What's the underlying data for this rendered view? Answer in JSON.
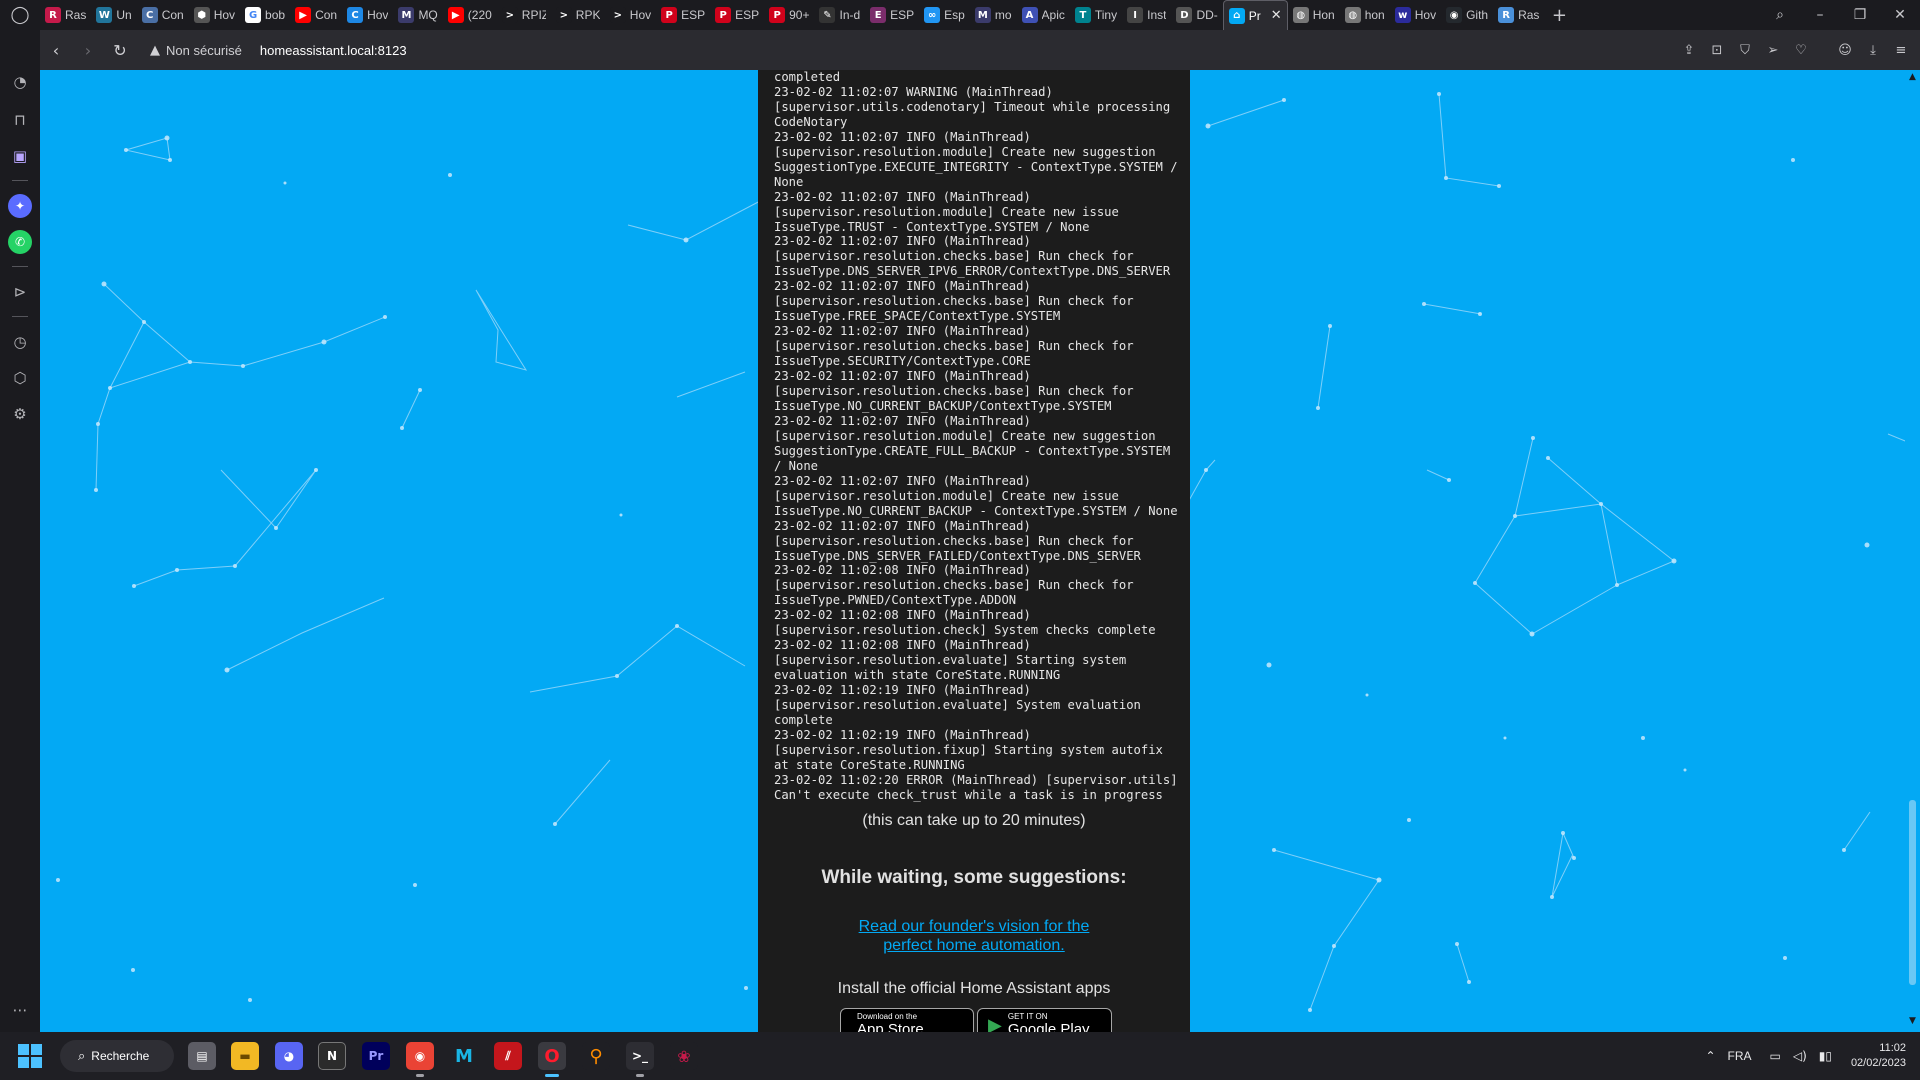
{
  "browser": {
    "tabs": [
      {
        "label": "Ras",
        "icon": "raspberry-favicon-icon",
        "color": "#c51a4a",
        "glyph": "R"
      },
      {
        "label": "Un",
        "icon": "wordpress-favicon-icon",
        "color": "#21759b",
        "glyph": "W"
      },
      {
        "label": "Con",
        "icon": "globe-favicon-icon",
        "color": "#4a6fa5",
        "glyph": "C"
      },
      {
        "label": "Hov",
        "icon": "hexagon-favicon-icon",
        "color": "#555",
        "glyph": "⬢"
      },
      {
        "label": "bob",
        "icon": "google-favicon-icon",
        "color": "#fff",
        "glyph": "G"
      },
      {
        "label": "Con",
        "icon": "youtube-favicon-icon",
        "color": "#ff0000",
        "glyph": "▶"
      },
      {
        "label": "Hov",
        "icon": "circle-favicon-icon",
        "color": "#1e88e5",
        "glyph": "C"
      },
      {
        "label": "MQ",
        "icon": "mq-favicon-icon",
        "color": "#3b3b6b",
        "glyph": "M"
      },
      {
        "label": "(220",
        "icon": "youtube-favicon-icon",
        "color": "#ff0000",
        "glyph": "▶"
      },
      {
        "label": "RPIZ",
        "icon": "terminal-favicon-icon",
        "color": "#1b1b1f",
        "glyph": ">"
      },
      {
        "label": "RPK",
        "icon": "terminal-favicon-icon",
        "color": "#1b1b1f",
        "glyph": ">"
      },
      {
        "label": "Hov",
        "icon": "terminal-favicon-icon",
        "color": "#1b1b1f",
        "glyph": ">"
      },
      {
        "label": "ESP",
        "icon": "p-favicon-icon",
        "color": "#d0021b",
        "glyph": "P"
      },
      {
        "label": "ESP",
        "icon": "p-favicon-icon",
        "color": "#d0021b",
        "glyph": "P"
      },
      {
        "label": "90+",
        "icon": "p-favicon-icon",
        "color": "#d0021b",
        "glyph": "P"
      },
      {
        "label": "In-d",
        "icon": "pen-favicon-icon",
        "color": "#333",
        "glyph": "✎"
      },
      {
        "label": "ESP",
        "icon": "esp-favicon-icon",
        "color": "#7b2d6b",
        "glyph": "E"
      },
      {
        "label": "Esp",
        "icon": "esp-loop-favicon-icon",
        "color": "#2196f3",
        "glyph": "∞"
      },
      {
        "label": "mo",
        "icon": "mq-favicon-icon",
        "color": "#3b3b6b",
        "glyph": "M"
      },
      {
        "label": "Apic",
        "icon": "api-favicon-icon",
        "color": "#3f51b5",
        "glyph": "A"
      },
      {
        "label": "Tiny",
        "icon": "tiny-favicon-icon",
        "color": "#00838f",
        "glyph": "T"
      },
      {
        "label": "Inst",
        "icon": "install-favicon-icon",
        "color": "#444",
        "glyph": "I"
      },
      {
        "label": "DD-",
        "icon": "dd-favicon-icon",
        "color": "#555",
        "glyph": "D"
      },
      {
        "label": "Pr",
        "icon": "home-assistant-favicon-icon",
        "color": "#03a9f4",
        "glyph": "⌂",
        "active": true
      },
      {
        "label": "Hon",
        "icon": "globe-favicon-icon",
        "color": "#777",
        "glyph": "◍"
      },
      {
        "label": "hon",
        "icon": "globe-favicon-icon",
        "color": "#777",
        "glyph": "◍"
      },
      {
        "label": "Hov",
        "icon": "wiki-favicon-icon",
        "color": "#2b2b9c",
        "glyph": "w"
      },
      {
        "label": "Gith",
        "icon": "github-favicon-icon",
        "color": "#24292e",
        "glyph": "◉"
      },
      {
        "label": "Ras",
        "icon": "raspberry-favicon-icon",
        "color": "#4a90d9",
        "glyph": "R"
      }
    ],
    "security_label": "Non sécurisé",
    "url": "homeassistant.local:8123"
  },
  "page": {
    "log_lines": [
      "completed",
      "23-02-02 11:02:07 WARNING (MainThread)",
      "[supervisor.utils.codenotary] Timeout while processing",
      "CodeNotary",
      "23-02-02 11:02:07 INFO (MainThread)",
      "[supervisor.resolution.module] Create new suggestion",
      "SuggestionType.EXECUTE_INTEGRITY - ContextType.SYSTEM /",
      "None",
      "23-02-02 11:02:07 INFO (MainThread)",
      "[supervisor.resolution.module] Create new issue",
      "IssueType.TRUST - ContextType.SYSTEM / None",
      "23-02-02 11:02:07 INFO (MainThread)",
      "[supervisor.resolution.checks.base] Run check for",
      "IssueType.DNS_SERVER_IPV6_ERROR/ContextType.DNS_SERVER",
      "23-02-02 11:02:07 INFO (MainThread)",
      "[supervisor.resolution.checks.base] Run check for",
      "IssueType.FREE_SPACE/ContextType.SYSTEM",
      "23-02-02 11:02:07 INFO (MainThread)",
      "[supervisor.resolution.checks.base] Run check for",
      "IssueType.SECURITY/ContextType.CORE",
      "23-02-02 11:02:07 INFO (MainThread)",
      "[supervisor.resolution.checks.base] Run check for",
      "IssueType.NO_CURRENT_BACKUP/ContextType.SYSTEM",
      "23-02-02 11:02:07 INFO (MainThread)",
      "[supervisor.resolution.module] Create new suggestion",
      "SuggestionType.CREATE_FULL_BACKUP - ContextType.SYSTEM",
      "/ None",
      "23-02-02 11:02:07 INFO (MainThread)",
      "[supervisor.resolution.module] Create new issue",
      "IssueType.NO_CURRENT_BACKUP - ContextType.SYSTEM / None",
      "23-02-02 11:02:07 INFO (MainThread)",
      "[supervisor.resolution.checks.base] Run check for",
      "IssueType.DNS_SERVER_FAILED/ContextType.DNS_SERVER",
      "23-02-02 11:02:08 INFO (MainThread)",
      "[supervisor.resolution.checks.base] Run check for",
      "IssueType.PWNED/ContextType.ADDON",
      "23-02-02 11:02:08 INFO (MainThread)",
      "[supervisor.resolution.check] System checks complete",
      "23-02-02 11:02:08 INFO (MainThread)",
      "[supervisor.resolution.evaluate] Starting system",
      "evaluation with state CoreState.RUNNING",
      "23-02-02 11:02:19 INFO (MainThread)",
      "[supervisor.resolution.evaluate] System evaluation",
      "complete",
      "23-02-02 11:02:19 INFO (MainThread)",
      "[supervisor.resolution.fixup] Starting system autofix",
      "at state CoreState.RUNNING",
      "23-02-02 11:02:20 ERROR (MainThread) [supervisor.utils]",
      "Can't execute check_trust while a task is in progress"
    ],
    "wait_note": "(this can take up to 20 minutes)",
    "suggestions_heading": "While waiting, some suggestions:",
    "vision_link_line1": "Read our founder's vision for the",
    "vision_link_line2": "perfect home automation.",
    "install_heading": "Install the official Home Assistant apps",
    "appstore_small": "Download on the",
    "appstore_big": "App Store",
    "googleplay_small": "GET IT ON",
    "googleplay_big": "Google Play"
  },
  "taskbar": {
    "search_label": "Recherche",
    "language": "FRA",
    "time": "11:02",
    "date": "02/02/2023"
  },
  "colors": {
    "accent": "#03a9f4",
    "log_bg": "#1c1c1c",
    "browser_chrome": "#1b1b1f"
  }
}
